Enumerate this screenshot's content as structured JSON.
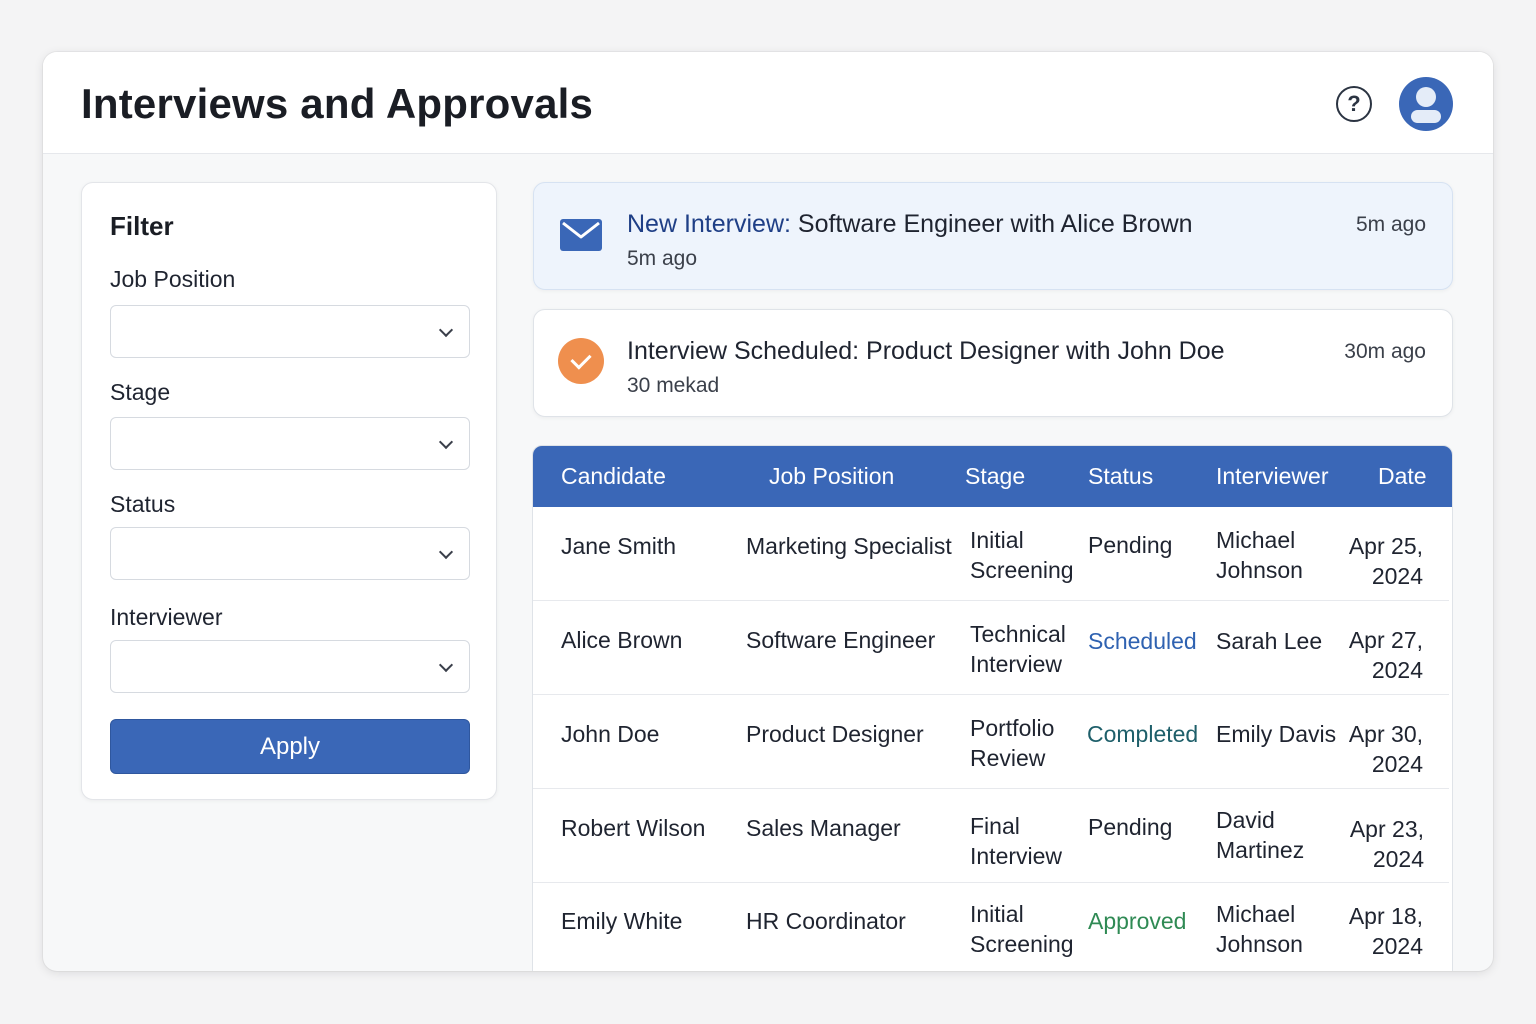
{
  "header": {
    "title": "Interviews and Approvals",
    "help_icon": "question-circle-icon",
    "avatar_icon": "user-avatar-icon"
  },
  "filter": {
    "title": "Filter",
    "fields": [
      {
        "label": "Job Position",
        "value": ""
      },
      {
        "label": "Stage",
        "value": ""
      },
      {
        "label": "Status",
        "value": ""
      },
      {
        "label": "Interviewer",
        "value": ""
      }
    ],
    "apply_label": "Apply"
  },
  "notifications": [
    {
      "icon": "mail-icon",
      "title_prefix": "New Interview:",
      "title_rest": " Software Engineer with Alice Brown",
      "subtitle": "5m ago",
      "time": "5m ago"
    },
    {
      "icon": "check-circle-icon",
      "title": "Interview Scheduled: Product Designer with John Doe",
      "subtitle": "30 mekad",
      "time": "30m ago"
    }
  ],
  "table": {
    "columns": [
      "Candidate",
      "Job Position",
      "Stage",
      "Status",
      "Interviewer",
      "Date"
    ],
    "rows": [
      {
        "candidate": "Jane Smith",
        "position": "Marketing Specialist",
        "stage": [
          "Initial",
          "Screening"
        ],
        "status": "Pending",
        "interviewer": [
          "Michael",
          "Johnson"
        ],
        "date": [
          "Apr 25,",
          "2024"
        ]
      },
      {
        "candidate": "Alice Brown",
        "position": "Software Engineer",
        "stage": [
          "Technical",
          "Interview"
        ],
        "status": "Scheduled",
        "interviewer": [
          "Sarah Lee"
        ],
        "date": [
          "Apr 27,",
          "2024"
        ]
      },
      {
        "candidate": "John Doe",
        "position": "Product Designer",
        "stage": [
          "Portfolio",
          "Review"
        ],
        "status": "Completed",
        "interviewer": [
          "Emily Davis"
        ],
        "date": [
          "Apr 30,",
          "2024"
        ]
      },
      {
        "candidate": "Robert Wilson",
        "position": "Sales Manager",
        "stage": [
          "Final",
          "Interview"
        ],
        "status": "Pending",
        "interviewer": [
          "David",
          "Martinez"
        ],
        "date": [
          "Apr 23,",
          "2024"
        ]
      },
      {
        "candidate": "Emily White",
        "position": "HR Coordinator",
        "stage": [
          "Initial",
          "Screening"
        ],
        "status": "Approved",
        "interviewer": [
          "Michael",
          "Johnson"
        ],
        "date": [
          "Apr 18,",
          "2024"
        ]
      }
    ]
  },
  "colors": {
    "accent": "#3a67b7",
    "notification_highlight": "#eef4fc",
    "check_orange": "#ef8f4e",
    "status_scheduled": "#2f62b1",
    "status_completed": "#1e5f6a",
    "status_approved": "#2f8a54"
  }
}
